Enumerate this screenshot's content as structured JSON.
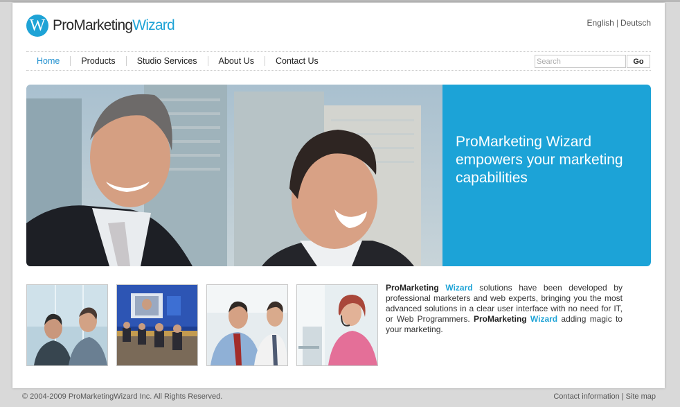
{
  "header": {
    "logo": {
      "letter": "W",
      "name_part1": "ProMarketing",
      "name_part2": "Wizard"
    },
    "languages": [
      "English",
      "Deutsch"
    ],
    "language_separator": "|"
  },
  "nav": {
    "items": [
      {
        "label": "Home",
        "active": true
      },
      {
        "label": "Products",
        "active": false
      },
      {
        "label": "Studio Services",
        "active": false
      },
      {
        "label": "About Us",
        "active": false
      },
      {
        "label": "Contact Us",
        "active": false
      }
    ]
  },
  "search": {
    "placeholder": "Search",
    "value": "",
    "button_label": "Go"
  },
  "hero": {
    "headline": "ProMarketing Wizard empowers your marketing capabilities",
    "panel_color": "#1ca3d7"
  },
  "thumbnails": [
    {
      "name": "thumb-professionals-glass"
    },
    {
      "name": "thumb-conference-panel"
    },
    {
      "name": "thumb-office-colleagues"
    },
    {
      "name": "thumb-headset-operator"
    }
  ],
  "intro": {
    "brand_part1": "ProMarketing",
    "brand_part2": "Wizard",
    "text_1": " solutions have been developed by professional marketers and web experts, bringing you the most advanced solutions in a clear user interface with no need for IT, or Web Programmers. ",
    "text_2": " adding magic to your marketing."
  },
  "footer": {
    "copyright": "© 2004-2009 ProMarketingWizard Inc. All Rights Reserved.",
    "links": [
      "Contact information",
      "Site map"
    ],
    "separator": "|"
  },
  "colors": {
    "accent": "#1ea3d6",
    "nav_active": "#1e8fcf",
    "page_background": "#d9d9d9"
  }
}
